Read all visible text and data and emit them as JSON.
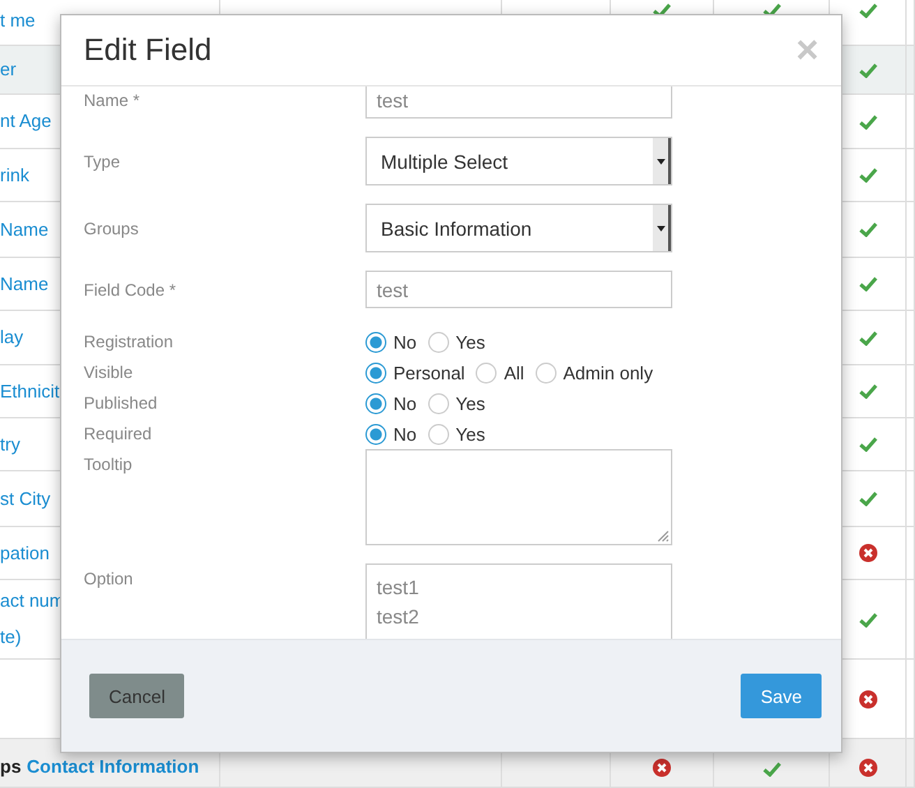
{
  "table": {
    "rows": [
      {
        "highlighted": false,
        "column_1": "t me",
        "column_4": true,
        "column_5": true,
        "column_6": true
      },
      {
        "highlighted": true,
        "column_1": "er",
        "column_6": true
      },
      {
        "highlighted": false,
        "column_1": "nt Age",
        "column_6": true
      },
      {
        "highlighted": false,
        "column_1": "rink",
        "column_6": true
      },
      {
        "highlighted": false,
        "column_1": "Name",
        "column_6": true
      },
      {
        "highlighted": false,
        "column_1": "Name",
        "column_6": true
      },
      {
        "highlighted": false,
        "column_1": "lay",
        "column_6": true
      },
      {
        "highlighted": false,
        "column_1": "Ethnicit",
        "column_6": true
      },
      {
        "highlighted": false,
        "column_1": "try",
        "column_6": true
      },
      {
        "highlighted": false,
        "column_1": "st City",
        "column_6": true
      },
      {
        "highlighted": false,
        "column_1": "pation",
        "column_6": false
      },
      {
        "highlighted": false,
        "column_1": "act num\nte)",
        "column_6": true
      },
      {
        "highlighted": false,
        "column_6": false
      },
      {
        "highlighted": false,
        "group": true,
        "column_1_prefix": "ps",
        "column_1": "Contact Information",
        "column_4": false,
        "column_5": true,
        "column_6": false
      }
    ]
  },
  "dialog": {
    "title": "Edit Field",
    "close": "×",
    "fields": [
      {
        "kind": "text",
        "label": "Name *",
        "value": "test"
      },
      {
        "kind": "select",
        "label": "Type",
        "value": "Multiple Select"
      },
      {
        "kind": "select",
        "label": "Groups",
        "value": "Basic Information"
      },
      {
        "kind": "text",
        "label": "Field Code *",
        "value": "test"
      },
      {
        "kind": "radio",
        "label": "Registration",
        "options": [
          {
            "label": "No",
            "selected": true
          },
          {
            "label": "Yes",
            "selected": false
          }
        ]
      },
      {
        "kind": "radio",
        "label": "Visible",
        "options": [
          {
            "label": "Personal",
            "selected": true
          },
          {
            "label": "All",
            "selected": false
          },
          {
            "label": "Admin only",
            "selected": false
          }
        ]
      },
      {
        "kind": "radio",
        "label": "Published",
        "options": [
          {
            "label": "No",
            "selected": true
          },
          {
            "label": "Yes",
            "selected": false
          }
        ]
      },
      {
        "kind": "radio",
        "label": "Required",
        "options": [
          {
            "label": "No",
            "selected": true
          },
          {
            "label": "Yes",
            "selected": false
          }
        ]
      },
      {
        "kind": "textarea",
        "label": "Tooltip"
      },
      {
        "kind": "textarea",
        "label": "Option",
        "value": "test1\ntest2"
      }
    ],
    "buttons": [
      {
        "kind": "secondary",
        "label": "Cancel"
      },
      {
        "kind": "primary",
        "label": "Save"
      }
    ]
  }
}
